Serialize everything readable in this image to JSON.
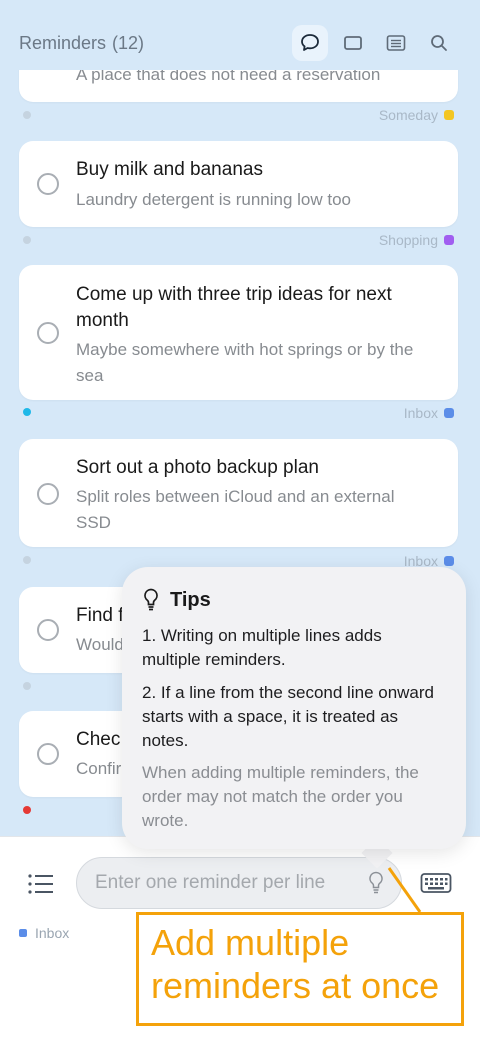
{
  "header": {
    "title": "Reminders",
    "count": "(12)",
    "icons": [
      "chat-bubble-icon",
      "card-view-icon",
      "list-view-icon",
      "search-icon"
    ]
  },
  "reminders": [
    {
      "title": "",
      "note": "A place that does not need a reservation",
      "tag": "Someday",
      "tag_color": "#f3c623"
    },
    {
      "title": "Buy milk and bananas",
      "note": "Laundry detergent is running low too",
      "tag": "Shopping",
      "tag_color": "#a15ef0"
    },
    {
      "title": "Come up with three trip ideas for next month",
      "note": "Maybe somewhere with hot springs or by the sea",
      "tag": "Inbox",
      "tag_color": "#5b8de8"
    },
    {
      "title": "Sort out a photo backup plan",
      "note": "Split roles between iCloud and an external SSD",
      "tag": "Inbox",
      "tag_color": "#5b8de8"
    },
    {
      "title": "Find f",
      "note": "Would"
    },
    {
      "title": "Chec",
      "note": "Confir"
    }
  ],
  "tips": {
    "title": "Tips",
    "line1": "1. Writing on multiple lines adds multiple reminders.",
    "line2": "2. If a line from the second line onward starts with a space, it is treated as notes.",
    "line3": "When adding multiple reminders, the order may not match the order you wrote."
  },
  "composer": {
    "placeholder": "Enter one reminder per line",
    "list_label": "Inbox"
  },
  "callout": {
    "text_line1": "Add multiple",
    "text_line2": "reminders at once",
    "color": "#f4a20a"
  }
}
